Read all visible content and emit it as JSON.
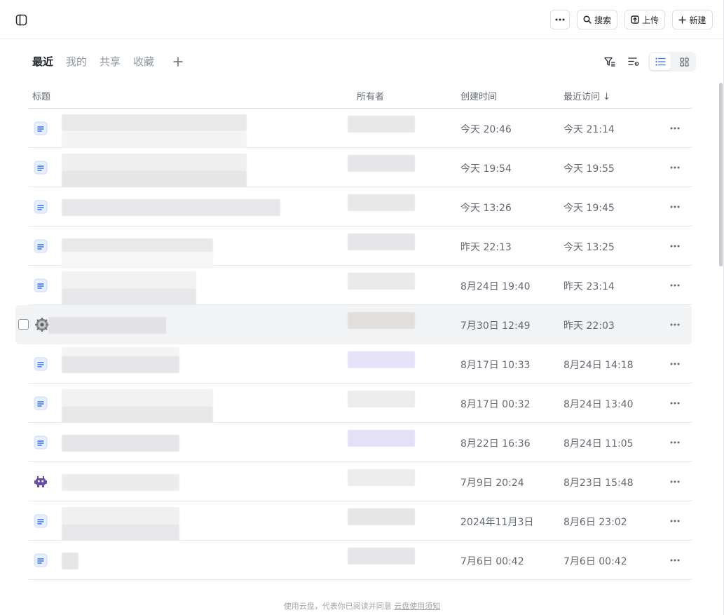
{
  "topbar": {
    "more_label": "",
    "search_label": "搜索",
    "upload_label": "上传",
    "new_label": "新建"
  },
  "tabs": [
    {
      "label": "最近",
      "active": true
    },
    {
      "label": "我的",
      "active": false
    },
    {
      "label": "共享",
      "active": false
    },
    {
      "label": "收藏",
      "active": false
    }
  ],
  "table": {
    "columns": {
      "title": "标题",
      "owner": "所有者",
      "created": "创建时间",
      "visited": "最近访问 ↓"
    },
    "rows": [
      {
        "icon": "doc-icon",
        "created": "今天 20:46",
        "visited": "今天 21:14"
      },
      {
        "icon": "doc-icon",
        "created": "今天 19:54",
        "visited": "今天 19:55"
      },
      {
        "icon": "doc-icon",
        "created": "今天 13:26",
        "visited": "今天 19:45"
      },
      {
        "icon": "doc-icon",
        "created": "昨天 22:13",
        "visited": "今天 13:25"
      },
      {
        "icon": "doc-icon",
        "created": "8月24日 19:40",
        "visited": "昨天 23:14"
      },
      {
        "icon": "gear-emoji-icon",
        "created": "7月30日 12:49",
        "visited": "昨天 22:03"
      },
      {
        "icon": "doc-icon",
        "created": "8月17日 10:33",
        "visited": "8月24日 14:18"
      },
      {
        "icon": "doc-icon",
        "created": "8月17日 00:32",
        "visited": "8月24日 13:40"
      },
      {
        "icon": "doc-icon",
        "created": "8月22日 16:36",
        "visited": "8月24日 11:05"
      },
      {
        "icon": "alien-emoji-icon",
        "created": "7月9日 20:24",
        "visited": "8月23日 15:48"
      },
      {
        "icon": "doc-icon",
        "created": "2024年11月3日",
        "visited": "8月6日 23:02"
      },
      {
        "icon": "doc-icon",
        "created": "7月6日 00:42",
        "visited": "7月6日 00:42"
      }
    ]
  },
  "footer": {
    "text": "使用云盘，代表你已阅读并同意",
    "link": "云盘使用须知"
  },
  "colors": {
    "accent": "#3370ff",
    "doc_icon_bg": "#e8f0ff",
    "hover_row": "#f2f3f5"
  }
}
